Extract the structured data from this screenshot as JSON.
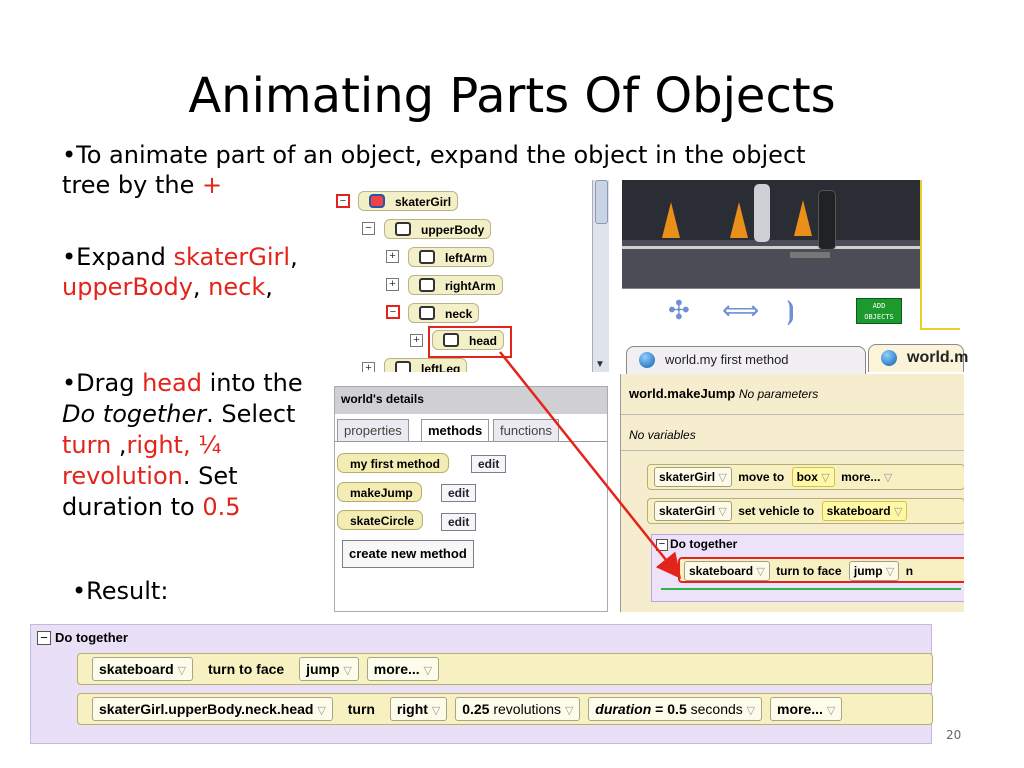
{
  "slide": {
    "title": "Animating Parts Of Objects",
    "page_number": "20",
    "bullets": {
      "b1_a": "•To animate part of an object, expand the object in the object",
      "b1_b": "tree by the ",
      "b1_plus": "+",
      "b2_pre": "•Expand ",
      "b2_skater": "skaterGirl",
      "b2_comma1": ",",
      "b2_upper": "upperBody",
      "b2_comma2": ", ",
      "b2_neck": "neck",
      "b2_comma3": ",",
      "b3_pre": "•Drag ",
      "b3_head": "head",
      "b3_post": " into the",
      "b3_doto": "Do together",
      "b3_select": ". Select",
      "b3_turn": "turn",
      "b3_mid": " ,",
      "b3_right": "right, ¼",
      "b3_rev": "revolution",
      "b3_set": ". Set",
      "b3_dur": "duration to ",
      "b3_val": "0.5",
      "b4": "•Result:"
    }
  },
  "object_tree": {
    "nodes": [
      "skaterGirl",
      "upperBody",
      "leftArm",
      "rightArm",
      "neck",
      "head",
      "leftLeg"
    ]
  },
  "world_view": {
    "add_objects_line1": "ADD",
    "add_objects_line2": "OBJECTS"
  },
  "method_tabs": [
    "world.my first method",
    "world.m"
  ],
  "details_panel": {
    "header": "world's details",
    "tabs": [
      "properties",
      "methods",
      "functions"
    ],
    "methods": [
      "my first method",
      "makeJump",
      "skateCircle"
    ],
    "edit_label": "edit",
    "create_label": "create new method"
  },
  "method_editor": {
    "method_name": "world.makeJump",
    "params": "No parameters",
    "variables": "No variables",
    "stmt1": {
      "obj": "skaterGirl",
      "verb": "move to",
      "target": "box",
      "more": "more..."
    },
    "stmt2": {
      "obj": "skaterGirl",
      "verb": "set",
      "word1": "vehicle",
      "word2": "to",
      "target": "skateboard"
    },
    "do_together": "Do together",
    "stmt3": {
      "obj": "skateboard",
      "verb": "turn to face",
      "target": "jump",
      "tail": "n"
    }
  },
  "result": {
    "do_together": "Do together",
    "row1": {
      "obj": "skateboard",
      "verb": "turn to face",
      "target": "jump",
      "more": "more..."
    },
    "row2": {
      "obj": "skaterGirl.upperBody.neck.head",
      "verb": "turn",
      "dir": "right",
      "amount_num": "0.25",
      "amount_unit": "revolutions",
      "dur_label": "duration",
      "dur_eq": " = ",
      "dur_num": "0.5",
      "dur_unit": "seconds",
      "more": "more..."
    }
  },
  "colors": {
    "accent_red": "#e3241b",
    "do_together_bg": "#e9e0f7",
    "statement_bg": "#f7f1c2",
    "add_objects_green": "#1c9a2e"
  }
}
